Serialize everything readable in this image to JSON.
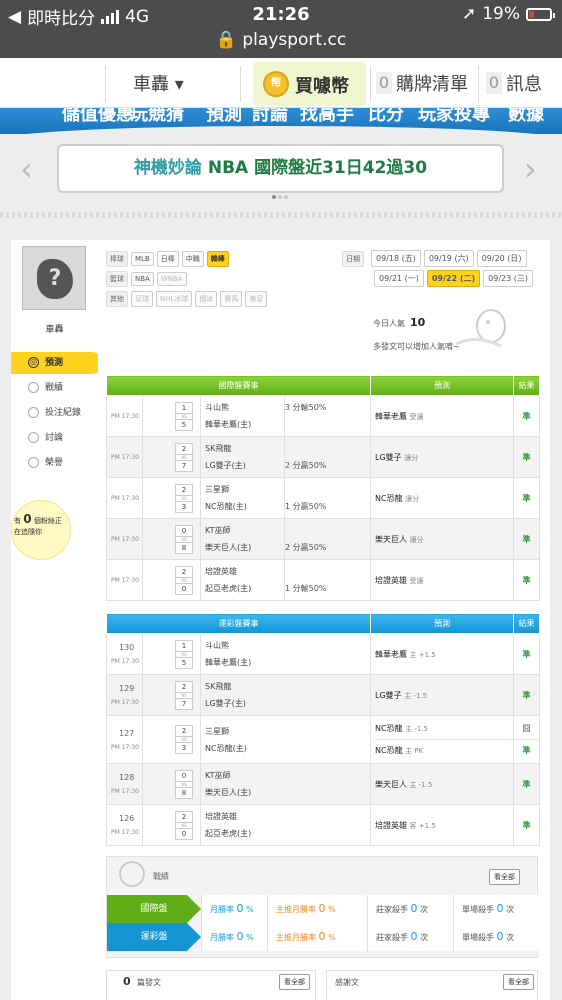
{
  "status": {
    "carrier": "即時比分",
    "network": "4G",
    "time": "21:26",
    "battery": "19%"
  },
  "url": "playsport.cc",
  "nav": {
    "user": "車轟 ▾",
    "coin_icon": "幣",
    "buy_coin": "買噱幣",
    "cart_count": "0",
    "cart": "購牌清單",
    "msg_count": "0",
    "messages": "訊息",
    "menu": [
      "儲值優惠",
      "玩競猜",
      "預測",
      "討論",
      "找高手",
      "比分",
      "玩家投專",
      "數據"
    ]
  },
  "banner": {
    "prefix": "神機妙論",
    "text": " NBA 國際盤近31日42過30"
  },
  "sidebar": {
    "username": "車轟",
    "items": [
      {
        "label": "預測",
        "icon": "target-icon"
      },
      {
        "label": "戰績",
        "icon": "chat-icon"
      },
      {
        "label": "投注紀錄",
        "icon": "record-icon"
      },
      {
        "label": "討論",
        "icon": "clock-icon"
      },
      {
        "label": "榮譽",
        "icon": "medal-icon"
      }
    ],
    "bulb_prefix": "有",
    "bulb_count": "0",
    "bulb_line1": "個粉絲正",
    "bulb_line2": "在追隨你"
  },
  "filters": {
    "baseball_label": "棒球",
    "baseball": [
      "MLB",
      "日棒",
      "中職",
      "韓棒"
    ],
    "basketball_label": "籃球",
    "basketball": [
      "NBA",
      "WNBA"
    ],
    "other_label": "其他",
    "other": [
      "足球",
      "NHL冰球",
      "俄冰",
      "賽馬",
      "美足"
    ],
    "date_label": "日期",
    "dates": [
      "09/18 (五)",
      "09/19 (六)",
      "09/20 (日)",
      "09/21 (一)",
      "09/22 (二)",
      "09/23 (三)"
    ]
  },
  "popularity": {
    "label": "今日人氣",
    "value": "10",
    "hint": "多發文可以增加人氣唷~"
  },
  "intl": {
    "headers": [
      "國際盤賽事",
      "預測",
      "結果"
    ],
    "rows": [
      {
        "time": "PM 17:30",
        "s1": "1",
        "s2": "5",
        "t1": "斗山熊",
        "t2": "韓華老鷹(主)",
        "o1": "3 分輸50%",
        "o2": "",
        "pred": "韓華老鷹",
        "ps": "受讓",
        "res": "準"
      },
      {
        "time": "PM 17:30",
        "s1": "2",
        "s2": "7",
        "t1": "SK飛龍",
        "t2": "LG雙子(主)",
        "o1": "",
        "o2": "2 分贏50%",
        "pred": "LG雙子",
        "ps": "讓分",
        "res": "準"
      },
      {
        "time": "PM 17:30",
        "s1": "2",
        "s2": "3",
        "t1": "三星獅",
        "t2": "NC恐龍(主)",
        "o1": "",
        "o2": "1 分贏50%",
        "pred": "NC恐龍",
        "ps": "讓分",
        "res": "準"
      },
      {
        "time": "PM 17:30",
        "s1": "0",
        "s2": "8",
        "t1": "KT巫師",
        "t2": "樂天巨人(主)",
        "o1": "",
        "o2": "2 分贏50%",
        "pred": "樂天巨人",
        "ps": "讓分",
        "res": "準"
      },
      {
        "time": "PM 17:30",
        "s1": "2",
        "s2": "0",
        "t1": "培證英雄",
        "t2": "起亞老虎(主)",
        "o1": "",
        "o2": "1 分輸50%",
        "pred": "培證英雄",
        "ps": "受讓",
        "res": "準"
      }
    ]
  },
  "lottery": {
    "headers": [
      "運彩盤賽事",
      "預測",
      "結果"
    ],
    "rows": [
      {
        "id": "130",
        "time": "PM 17:30",
        "s1": "1",
        "s2": "5",
        "t1": "斗山熊",
        "t2": "韓華老鷹(主)",
        "pred": "韓華老鷹",
        "ps": "主 +1.5",
        "res": "準"
      },
      {
        "id": "129",
        "time": "PM 17:30",
        "s1": "2",
        "s2": "7",
        "t1": "SK飛龍",
        "t2": "LG雙子(主)",
        "pred": "LG雙子",
        "ps": "主 -1.5",
        "res": "準"
      },
      {
        "id": "127",
        "time": "PM 17:30",
        "s1": "2",
        "s2": "3",
        "t1": "三星獅",
        "t2": "NC恐龍(主)",
        "pred": "NC恐龍",
        "ps": "主 -1.5",
        "res": "囧",
        "pred2": "NC恐龍",
        "ps2": "主 PK",
        "res2": "準"
      },
      {
        "id": "128",
        "time": "PM 17:30",
        "s1": "0",
        "s2": "8",
        "t1": "KT巫師",
        "t2": "樂天巨人(主)",
        "pred": "樂天巨人",
        "ps": "主 -1.5",
        "res": "準"
      },
      {
        "id": "126",
        "time": "PM 17:30",
        "s1": "2",
        "s2": "0",
        "t1": "培證英雄",
        "t2": "起亞老虎(主)",
        "pred": "培證英雄",
        "ps": "客 +1.5",
        "res": "準"
      }
    ]
  },
  "record": {
    "title": "戰績",
    "see_all": "看全部",
    "intl_label": "國際盤",
    "lottery_label": "運彩盤",
    "month_rate": "月勝率",
    "main_rate": "主推月勝率",
    "kill": "莊家殺手",
    "single_kill": "單場殺手",
    "zero": "0",
    "pct": "%",
    "times": "次"
  },
  "bottom": {
    "posts_count": "0",
    "posts": "篇發文",
    "see_all": "看全部",
    "thanks": "感謝文"
  },
  "colors": {
    "green": "#5fae17",
    "blue": "#1494d3",
    "yellow": "#ffd21f"
  }
}
